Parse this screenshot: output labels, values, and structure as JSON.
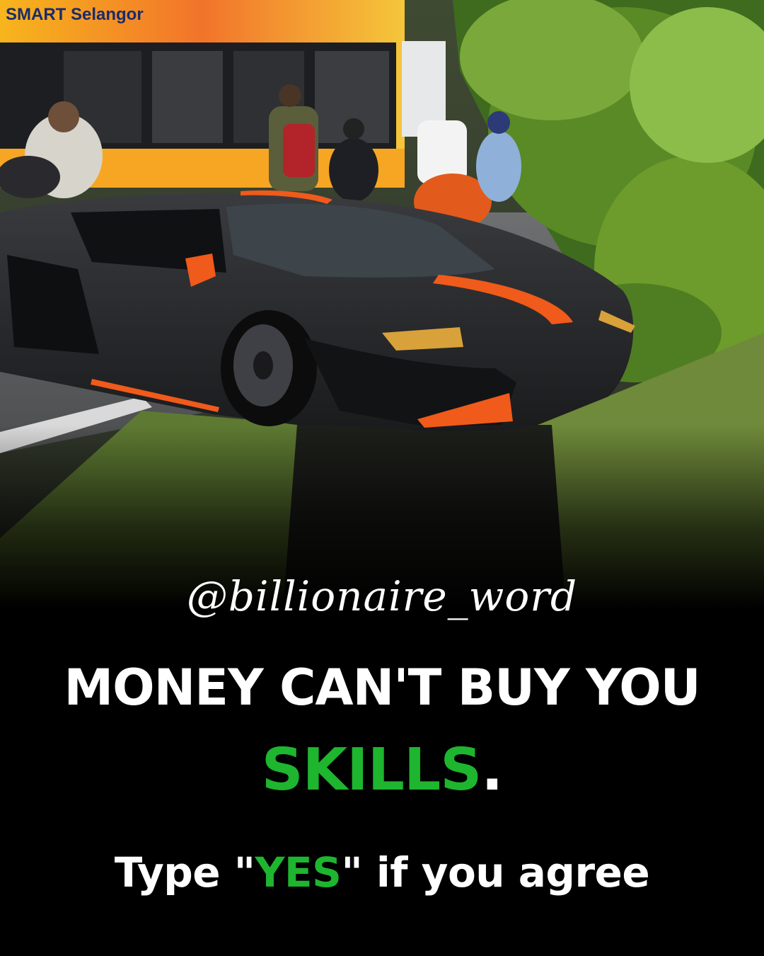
{
  "photo": {
    "bus_sign": "SMART Selangor",
    "subject": "black Lamborghini with orange stripe crashed into roadside ditch"
  },
  "handle": "@billionaire_word",
  "headline": {
    "line1": "MONEY CAN'T BUY YOU",
    "line2_highlight": "SKILLS",
    "line2_end": "."
  },
  "cta": {
    "before": "Type \"",
    "highlight": "YES",
    "after": "\" if you agree"
  },
  "colors": {
    "background": "#000000",
    "text": "#ffffff",
    "accent_green": "#1eb52f",
    "stripe_orange": "#f05a1a"
  }
}
